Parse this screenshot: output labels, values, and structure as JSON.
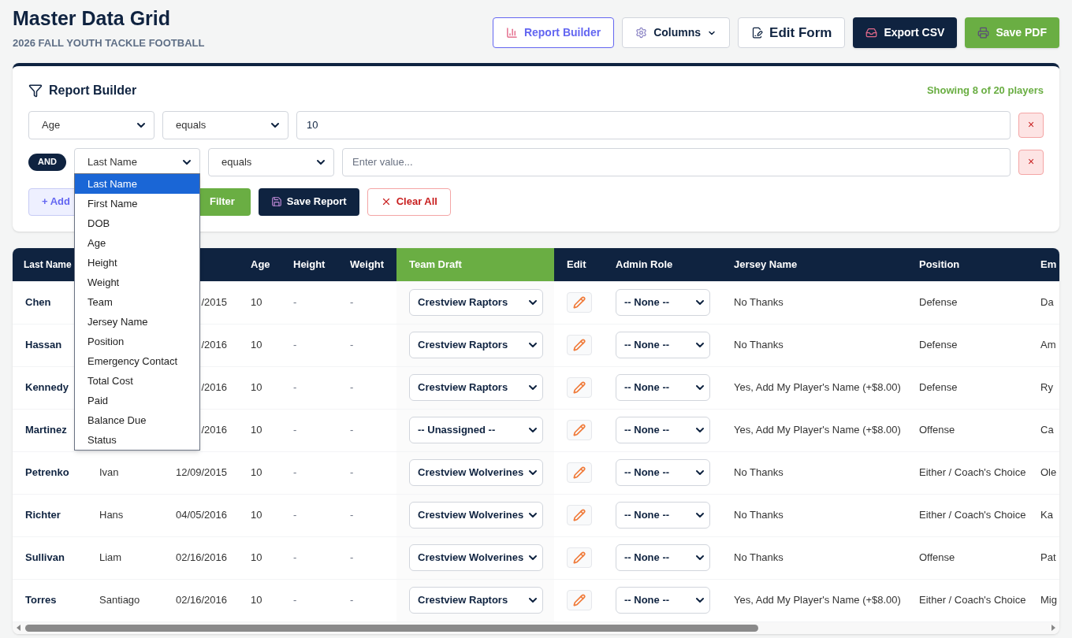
{
  "header": {
    "title": "Master Data Grid",
    "subtitle": "2026 FALL YOUTH TACKLE FOOTBALL",
    "buttons": [
      {
        "label": "Report Builder",
        "kind": "report"
      },
      {
        "label": "Columns",
        "kind": "columns"
      },
      {
        "label": "Edit Form",
        "kind": "edit"
      },
      {
        "label": "Export CSV",
        "kind": "export"
      },
      {
        "label": "Save PDF",
        "kind": "pdf"
      }
    ]
  },
  "report_builder": {
    "title": "Report Builder",
    "count": "Showing 8 of 20 players",
    "filters": [
      {
        "field": "Age",
        "operator": "equals",
        "value": "10",
        "remove": "×"
      },
      {
        "connector": "AND",
        "field": "Last Name",
        "operator": "equals",
        "placeholder": "Enter value...",
        "remove": "×"
      }
    ],
    "actions": [
      {
        "label": "+ Add",
        "kind": "add"
      },
      {
        "label": "Filter",
        "kind": "apply"
      },
      {
        "label": "Save Report",
        "kind": "save"
      },
      {
        "label": "Clear All",
        "kind": "clear"
      }
    ],
    "field_dropdown": {
      "options": [
        {
          "label": "Last Name",
          "selected": true
        },
        {
          "label": "First Name",
          "selected": false
        },
        {
          "label": "DOB",
          "selected": false
        },
        {
          "label": "Age",
          "selected": false
        },
        {
          "label": "Height",
          "selected": false
        },
        {
          "label": "Weight",
          "selected": false
        },
        {
          "label": "Team",
          "selected": false
        },
        {
          "label": "Jersey Name",
          "selected": false
        },
        {
          "label": "Position",
          "selected": false
        },
        {
          "label": "Emergency Contact",
          "selected": false
        },
        {
          "label": "Total Cost",
          "selected": false
        },
        {
          "label": "Paid",
          "selected": false
        },
        {
          "label": "Balance Due",
          "selected": false
        },
        {
          "label": "Status",
          "selected": false
        }
      ]
    }
  },
  "table": {
    "columns": [
      {
        "label": "Last Name",
        "kind": "bold",
        "highlight": false
      },
      {
        "kind": "text"
      },
      {
        "kind": "date"
      },
      {
        "label": "Age",
        "kind": "text",
        "highlight": false
      },
      {
        "label": "Height",
        "kind": "muted",
        "highlight": false
      },
      {
        "label": "Weight",
        "kind": "muted",
        "highlight": false
      },
      {
        "label": "Team Draft",
        "kind": "team-select",
        "highlight": true
      },
      {
        "label": "Edit",
        "kind": "edit",
        "highlight": false
      },
      {
        "label": "Admin Role",
        "kind": "role-select",
        "highlight": false
      },
      {
        "label": "Jersey Name",
        "kind": "text",
        "highlight": false
      },
      {
        "label": "Position",
        "kind": "text",
        "highlight": false
      },
      {
        "label": "Em",
        "kind": "text",
        "highlight": false
      }
    ],
    "rows": [
      {
        "last_name": "Chen",
        "dob": "/2015",
        "age": "10",
        "height": "-",
        "weight": "-",
        "team": "Crestview Raptors",
        "admin": "-- None --",
        "jersey": "No Thanks",
        "position": "Defense",
        "column_12": "Da"
      },
      {
        "last_name": "Hassan",
        "dob": "/2016",
        "age": "10",
        "height": "-",
        "weight": "-",
        "team": "Crestview Raptors",
        "admin": "-- None --",
        "jersey": "No Thanks",
        "position": "Defense",
        "column_12": "Am"
      },
      {
        "last_name": "Kennedy",
        "dob": "/2016",
        "age": "10",
        "height": "-",
        "weight": "-",
        "team": "Crestview Raptors",
        "admin": "-- None --",
        "jersey": "Yes, Add My Player's Name (+$8.00)",
        "position": "Defense",
        "column_12": "Ry"
      },
      {
        "last_name": "Martinez",
        "dob": "/2016",
        "age": "10",
        "height": "-",
        "weight": "-",
        "team": "-- Unassigned --",
        "admin": "-- None --",
        "jersey": "Yes, Add My Player's Name (+$8.00)",
        "position": "Offense",
        "column_12": "Ca"
      },
      {
        "last_name": "Petrenko",
        "first_name": "Ivan",
        "dob": "12/09/2015",
        "age": "10",
        "height": "-",
        "weight": "-",
        "team": "Crestview Wolverines",
        "admin": "-- None --",
        "jersey": "No Thanks",
        "position": "Either / Coach's Choice",
        "column_12": "Ole"
      },
      {
        "last_name": "Richter",
        "first_name": "Hans",
        "dob": "04/05/2016",
        "age": "10",
        "height": "-",
        "weight": "-",
        "team": "Crestview Wolverines",
        "admin": "-- None --",
        "jersey": "No Thanks",
        "position": "Either / Coach's Choice",
        "column_12": "Ka"
      },
      {
        "last_name": "Sullivan",
        "first_name": "Liam",
        "dob": "02/16/2016",
        "age": "10",
        "height": "-",
        "weight": "-",
        "team": "Crestview Wolverines",
        "admin": "-- None --",
        "jersey": "No Thanks",
        "position": "Offense",
        "column_12": "Pat"
      },
      {
        "last_name": "Torres",
        "first_name": "Santiago",
        "dob": "02/16/2016",
        "age": "10",
        "height": "-",
        "weight": "-",
        "team": "Crestview Raptors",
        "admin": "-- None --",
        "jersey": "Yes, Add My Player's Name (+$8.00)",
        "position": "Either / Coach's Choice",
        "column_12": "Mig"
      }
    ]
  }
}
